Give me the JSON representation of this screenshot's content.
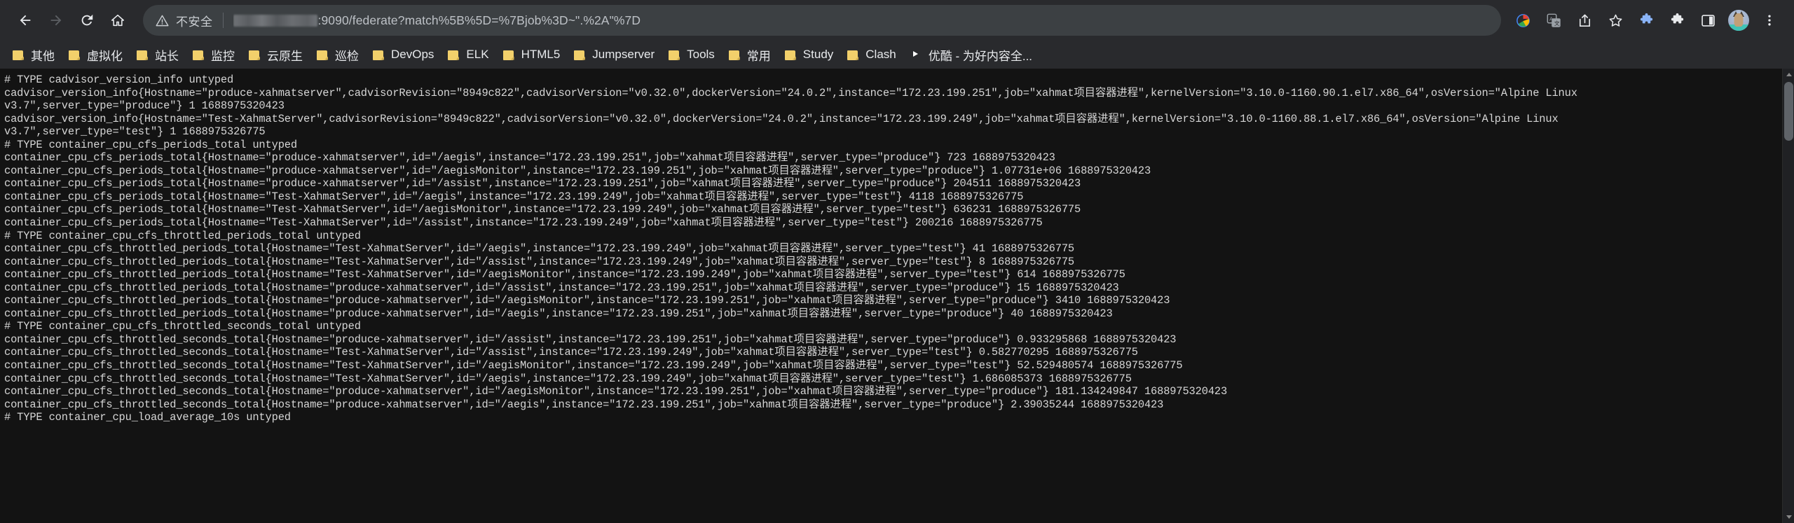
{
  "browser": {
    "nav": {
      "back_tooltip": "后退",
      "forward_tooltip": "前进",
      "reload_tooltip": "重新加载",
      "home_tooltip": "主页"
    },
    "omnibox": {
      "security_label": "不安全",
      "security_icon": "warning-triangle-icon",
      "url_host_redacted": true,
      "url_text": ":9090/federate?match%5B%5D=%7Bjob%3D~\".%2A\"%7D",
      "full_url_visible": ":9090/federate?match%5B%5D=%7Bjob%3D~\".%2A\"%7D"
    },
    "toolbar_right_icons": [
      {
        "name": "google-lens-icon",
        "glyph": "G"
      },
      {
        "name": "translate-icon",
        "glyph": "译"
      },
      {
        "name": "share-icon",
        "glyph": "share"
      },
      {
        "name": "bookmark-star-icon",
        "glyph": "star"
      },
      {
        "name": "extension-puzzle-a-icon",
        "glyph": "puzzle"
      },
      {
        "name": "extension-puzzle-b-icon",
        "glyph": "puzzle"
      },
      {
        "name": "side-panel-icon",
        "glyph": "panel"
      },
      {
        "name": "profile-avatar-icon",
        "glyph": "cat"
      },
      {
        "name": "chrome-menu-icon",
        "glyph": "kebab"
      }
    ],
    "bookmarks": [
      {
        "label": "其他",
        "icon": "folder-icon"
      },
      {
        "label": "虚拟化",
        "icon": "folder-icon"
      },
      {
        "label": "站长",
        "icon": "folder-icon"
      },
      {
        "label": "监控",
        "icon": "folder-icon"
      },
      {
        "label": "云原生",
        "icon": "folder-icon"
      },
      {
        "label": "巡检",
        "icon": "folder-icon"
      },
      {
        "label": "DevOps",
        "icon": "folder-icon"
      },
      {
        "label": "ELK",
        "icon": "folder-icon"
      },
      {
        "label": "HTML5",
        "icon": "folder-icon"
      },
      {
        "label": "Jumpserver",
        "icon": "folder-icon"
      },
      {
        "label": "Tools",
        "icon": "folder-icon"
      },
      {
        "label": "常用",
        "icon": "folder-icon"
      },
      {
        "label": "Study",
        "icon": "folder-icon"
      },
      {
        "label": "Clash",
        "icon": "folder-icon"
      },
      {
        "label": "优酷 - 为好内容全...",
        "icon": "youku-icon"
      }
    ]
  },
  "page": {
    "content_type": "prometheus-federate-plaintext",
    "body": "# TYPE cadvisor_version_info untyped\ncadvisor_version_info{Hostname=\"produce-xahmatserver\",cadvisorRevision=\"8949c822\",cadvisorVersion=\"v0.32.0\",dockerVersion=\"24.0.2\",instance=\"172.23.199.251\",job=\"xahmat项目容器进程\",kernelVersion=\"3.10.0-1160.90.1.el7.x86_64\",osVersion=\"Alpine Linux\nv3.7\",server_type=\"produce\"} 1 1688975320423\ncadvisor_version_info{Hostname=\"Test-XahmatServer\",cadvisorRevision=\"8949c822\",cadvisorVersion=\"v0.32.0\",dockerVersion=\"24.0.2\",instance=\"172.23.199.249\",job=\"xahmat项目容器进程\",kernelVersion=\"3.10.0-1160.88.1.el7.x86_64\",osVersion=\"Alpine Linux\nv3.7\",server_type=\"test\"} 1 1688975326775\n# TYPE container_cpu_cfs_periods_total untyped\ncontainer_cpu_cfs_periods_total{Hostname=\"produce-xahmatserver\",id=\"/aegis\",instance=\"172.23.199.251\",job=\"xahmat项目容器进程\",server_type=\"produce\"} 723 1688975320423\ncontainer_cpu_cfs_periods_total{Hostname=\"produce-xahmatserver\",id=\"/aegisMonitor\",instance=\"172.23.199.251\",job=\"xahmat项目容器进程\",server_type=\"produce\"} 1.07731e+06 1688975320423\ncontainer_cpu_cfs_periods_total{Hostname=\"produce-xahmatserver\",id=\"/assist\",instance=\"172.23.199.251\",job=\"xahmat项目容器进程\",server_type=\"produce\"} 204511 1688975320423\ncontainer_cpu_cfs_periods_total{Hostname=\"Test-XahmatServer\",id=\"/aegis\",instance=\"172.23.199.249\",job=\"xahmat项目容器进程\",server_type=\"test\"} 4118 1688975326775\ncontainer_cpu_cfs_periods_total{Hostname=\"Test-XahmatServer\",id=\"/aegisMonitor\",instance=\"172.23.199.249\",job=\"xahmat项目容器进程\",server_type=\"test\"} 636231 1688975326775\ncontainer_cpu_cfs_periods_total{Hostname=\"Test-XahmatServer\",id=\"/assist\",instance=\"172.23.199.249\",job=\"xahmat项目容器进程\",server_type=\"test\"} 200216 1688975326775\n# TYPE container_cpu_cfs_throttled_periods_total untyped\ncontainer_cpu_cfs_throttled_periods_total{Hostname=\"Test-XahmatServer\",id=\"/aegis\",instance=\"172.23.199.249\",job=\"xahmat项目容器进程\",server_type=\"test\"} 41 1688975326775\ncontainer_cpu_cfs_throttled_periods_total{Hostname=\"Test-XahmatServer\",id=\"/assist\",instance=\"172.23.199.249\",job=\"xahmat项目容器进程\",server_type=\"test\"} 8 1688975326775\ncontainer_cpu_cfs_throttled_periods_total{Hostname=\"Test-XahmatServer\",id=\"/aegisMonitor\",instance=\"172.23.199.249\",job=\"xahmat项目容器进程\",server_type=\"test\"} 614 1688975326775\ncontainer_cpu_cfs_throttled_periods_total{Hostname=\"produce-xahmatserver\",id=\"/assist\",instance=\"172.23.199.251\",job=\"xahmat项目容器进程\",server_type=\"produce\"} 15 1688975320423\ncontainer_cpu_cfs_throttled_periods_total{Hostname=\"produce-xahmatserver\",id=\"/aegisMonitor\",instance=\"172.23.199.251\",job=\"xahmat项目容器进程\",server_type=\"produce\"} 3410 1688975320423\ncontainer_cpu_cfs_throttled_periods_total{Hostname=\"produce-xahmatserver\",id=\"/aegis\",instance=\"172.23.199.251\",job=\"xahmat项目容器进程\",server_type=\"produce\"} 40 1688975320423\n# TYPE container_cpu_cfs_throttled_seconds_total untyped\ncontainer_cpu_cfs_throttled_seconds_total{Hostname=\"produce-xahmatserver\",id=\"/assist\",instance=\"172.23.199.251\",job=\"xahmat项目容器进程\",server_type=\"produce\"} 0.933295868 1688975320423\ncontainer_cpu_cfs_throttled_seconds_total{Hostname=\"Test-XahmatServer\",id=\"/assist\",instance=\"172.23.199.249\",job=\"xahmat项目容器进程\",server_type=\"test\"} 0.582770295 1688975326775\ncontainer_cpu_cfs_throttled_seconds_total{Hostname=\"Test-XahmatServer\",id=\"/aegisMonitor\",instance=\"172.23.199.249\",job=\"xahmat项目容器进程\",server_type=\"test\"} 52.529480574 1688975326775\ncontainer_cpu_cfs_throttled_seconds_total{Hostname=\"Test-XahmatServer\",id=\"/aegis\",instance=\"172.23.199.249\",job=\"xahmat项目容器进程\",server_type=\"test\"} 1.686085373 1688975326775\ncontainer_cpu_cfs_throttled_seconds_total{Hostname=\"produce-xahmatserver\",id=\"/aegisMonitor\",instance=\"172.23.199.251\",job=\"xahmat项目容器进程\",server_type=\"produce\"} 181.134249847 1688975320423\ncontainer_cpu_cfs_throttled_seconds_total{Hostname=\"produce-xahmatserver\",id=\"/aegis\",instance=\"172.23.199.251\",job=\"xahmat项目容器进程\",server_type=\"produce\"} 2.39035244 1688975320423\n# TYPE container_cpu_load_average_10s untyped"
  },
  "colors": {
    "chrome_bg": "#292a2d",
    "omnibox_bg": "#3c4043",
    "page_bg": "#131313",
    "page_text": "#d6d6d6",
    "bookmark_text": "#e8eaed",
    "folder_yellow": "#f2d06b",
    "scrollbar_thumb": "#5f6368"
  }
}
